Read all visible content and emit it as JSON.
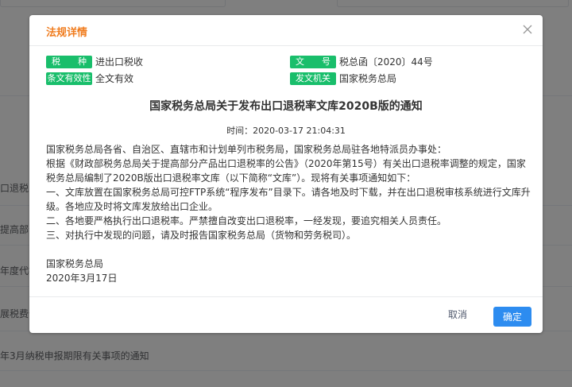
{
  "background": {
    "rows": [
      "口退税",
      "提高部分产",
      "年度代扣",
      "展税费优惠",
      "年3月纳税申报期限有关事项的通知"
    ]
  },
  "dialog": {
    "title": "法规详情",
    "meta": {
      "tax_type_label": "税　　种",
      "tax_type_value": "进出口税收",
      "doc_no_label": "文　　号",
      "doc_no_value": "税总函〔2020〕44号",
      "validity_label": "条文有效性",
      "validity_value": "全文有效",
      "issuer_label": "发文机关",
      "issuer_value": "国家税务总局"
    },
    "doc_title": "国家税务总局关于发布出口退税率文库2020B版的通知",
    "doc_time": "时间：2020-03-17 21:04:31",
    "body": [
      "国家税务总局各省、自治区、直辖市和计划单列市税务局，国家税务总局驻各地特派员办事处：",
      "根据《财政部税务总局关于提高部分产品出口退税率的公告》（2020年第15号）有关出口退税率调整的规定，国家税务总局编制了2020B版出口退税率文库（以下简称“文库”）。现将有关事项通知如下：",
      "一、文库放置在国家税务总局可控FTP系统“程序发布”目录下。请各地及时下载，并在出口退税审核系统进行文库升级。各地应及时将文库发放给出口企业。",
      "二、各地要严格执行出口退税率。严禁擅自改变出口退税率，一经发现，要追究相关人员责任。",
      "三、对执行中发现的问题，请及时报告国家税务总局（货物和劳务税司）。"
    ],
    "signature": "国家税务总局",
    "date": "2020年3月17日",
    "cancel_label": "取消",
    "ok_label": "确定"
  }
}
